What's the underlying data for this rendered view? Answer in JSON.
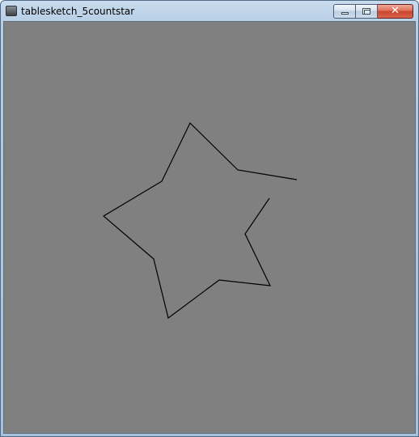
{
  "window": {
    "title": "tablesketch_5countstar",
    "icon": "app-window-icon"
  },
  "caption_buttons": {
    "minimize_icon": "minimize-icon",
    "maximize_icon": "maximize-icon",
    "close_icon": "close-icon",
    "close_glyph": "✕",
    "close_color": "#c8442b"
  },
  "canvas": {
    "background_color": "#808080",
    "stroke_color": "#000000"
  }
}
